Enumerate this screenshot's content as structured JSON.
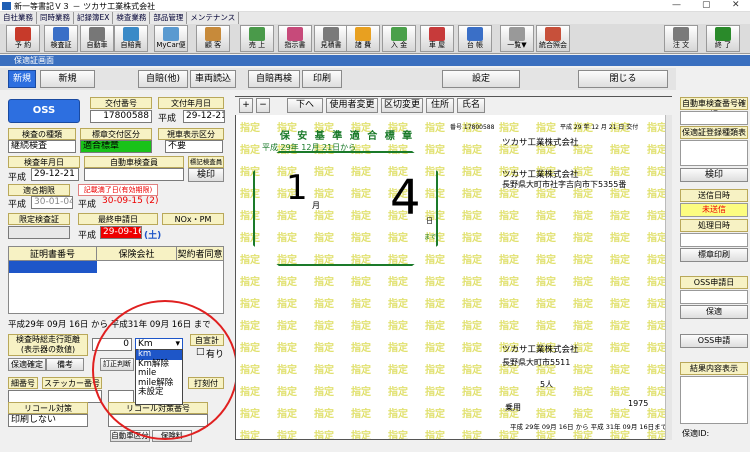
{
  "window": {
    "title": "新一等書記Ｖ３ － ツカサ工業株式会社",
    "min": "—",
    "max": "▢",
    "close": "✕"
  },
  "tabs": [
    "自社業務",
    "同時業務",
    "記録簿EX",
    "検査業務",
    "部品管理",
    "メンテナンス"
  ],
  "toolbar": [
    {
      "label": "予 約",
      "color": "#c73a2a"
    },
    {
      "label": "検査証",
      "color": "#3a6fc7"
    },
    {
      "label": "自動車",
      "color": "#777"
    },
    {
      "label": "自賠責",
      "color": "#3a8ac7"
    },
    {
      "label": "MyCar便",
      "color": "#5a9ad0"
    },
    {
      "label": "顧 客",
      "color": "#c78a3a"
    },
    {
      "label": "売 上",
      "color": "#4a9a4a"
    },
    {
      "label": "指示書",
      "color": "#c74a7a"
    },
    {
      "label": "見積書",
      "color": "#7a7a7a"
    },
    {
      "label": "諸 費",
      "color": "#e8a020"
    },
    {
      "label": "入 金",
      "color": "#4aa04a"
    },
    {
      "label": "車 屋",
      "color": "#c73a3a"
    },
    {
      "label": "台 帳",
      "color": "#3a6fc7"
    },
    {
      "label": "一覧▼",
      "color": "#999"
    },
    {
      "label": "統合照会",
      "color": "#c7503a"
    },
    {
      "label": "注 文",
      "color": "#7a7a7a"
    },
    {
      "label": "終 了",
      "color": "#2a8a2a"
    }
  ],
  "subbar": {
    "title": "保適証画面"
  },
  "actions": {
    "new": "新規",
    "new2": "新規",
    "jibai_other": "自賠(他)",
    "car_read": "車両読込",
    "jibai_again": "自賠再検",
    "print": "印刷",
    "settings": "設定",
    "close": "閉じる"
  },
  "left": {
    "oss": "OSS",
    "issue_no_label": "交付番号",
    "issue_no": "17800588",
    "issue_date_label": "文付年月日",
    "issue_date_era": "平成",
    "issue_date": "29-12-21",
    "insp_type_label": "検査の種類",
    "insp_type": "継続検査",
    "std_place_label": "標章交付区分",
    "std_place": "適合標章",
    "dept_label": "視車表示区分",
    "dept": "不要",
    "insp_date_label": "検査年月日",
    "insp_date_era": "平成",
    "insp_date": "29-12-21",
    "inspector_label": "自動車検査員",
    "inspector": "",
    "mark_label": "標記検査員",
    "mark_btn": "検印",
    "valid_label": "適合期限",
    "valid_era": "平成",
    "valid_date": "30-01-04",
    "record_label": "記載満了日(有効期限)",
    "record_era": "平成",
    "record_date": "30-09-15 (2)",
    "limit_label": "限定検査証",
    "last_label": "最終申請日",
    "nox_label": "NOx・PM",
    "last_date_era": "平成",
    "last_date": "29-09-16",
    "last_day": "(土)",
    "grid_cols": [
      "証明書番号",
      "保険会社",
      "契約者同意"
    ],
    "period": "平成29年 09月 16日 から 平成31年 09月 16日 まで",
    "odo_label": "検査時総走行距離\n(表示器の数値)",
    "odo_value": "0",
    "odo_unit": "Km",
    "self_total": "自宣計",
    "chk": "有り",
    "dd_options": [
      "km",
      "Km解除",
      "mile",
      "mile解除",
      "未設定"
    ],
    "tab1": "保適確定",
    "tab2": "備考",
    "tab3": "訂正判断",
    "seal_label": "細番号",
    "sticker_label": "ステッカー番号",
    "number_label": "打刻付",
    "recall_label": "リコール対策",
    "recall_no_label": "リコール対策番号",
    "recall_value": "印刷しない",
    "bottom_tab1": "自動車区分",
    "bottom_tab2": "保険料"
  },
  "doc": {
    "cert_title": "保 安 基 準 適 合 標 章",
    "cert_sub": "平成 29年 12月 21日から",
    "big_month": "1",
    "big_day": "4",
    "month_unit": "月",
    "day_unit": "日",
    "until": "まで",
    "watermark": "指定",
    "company1": "ツカサ工業株式会社",
    "address1": "長野県大町市社字吉向市下5355番",
    "owner": "ツカサ工業株式会社",
    "owner_address": "長野県大町市5511",
    "capacity": "5人",
    "weight": "1975",
    "use": "乗用",
    "period_text": "平成 29年 09月 16日 から 平成 31年 09月 16日まで",
    "header_no": "番号 17800588",
    "header_date": "平成 29 年 12 月 21 日 交付",
    "toolbar": [
      "+",
      "−",
      "下へ",
      "使用者変更",
      "区切変更",
      "住所",
      "氏名"
    ]
  },
  "right": {
    "reg_label": "自動車検査番号確認",
    "reg_no_label": "保適証登録種類表",
    "ken_btn": "検印",
    "send_label": "送信日時",
    "send_value": "未送信",
    "proc_label": "処理日時",
    "mark_print": "標章印刷",
    "oss_date": "OSS申請日",
    "hoteki": "保適",
    "oss_req": "OSS申請",
    "result_label": "結果内容表示",
    "id_label": "保適ID:"
  },
  "colors": {
    "accent": "#2d6fe0",
    "green": "#19c219",
    "red": "#e00000",
    "yellow": "#f7f2c4"
  }
}
